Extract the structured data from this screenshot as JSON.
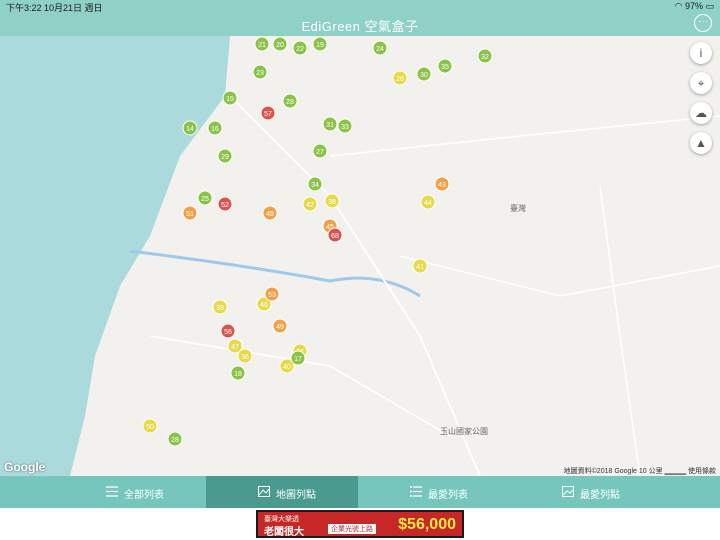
{
  "status_bar": {
    "time_date": "下午3:22  10月21日 週日",
    "battery": "97%"
  },
  "nav": {
    "title": "EdiGreen 空氣盒子",
    "more_icon": "more-icon"
  },
  "map": {
    "labels": [
      "臺灣",
      "玉山國家公園"
    ],
    "google": "Google",
    "attribution": "地圖資料©2018 Google   10 公里 ▁▁▁▁   使用條款",
    "side_buttons": [
      "info-icon",
      "location-pin-icon",
      "weather-icon",
      "layers-icon"
    ],
    "markers": [
      {
        "v": "21",
        "c": "green"
      },
      {
        "v": "20",
        "c": "green"
      },
      {
        "v": "22",
        "c": "green"
      },
      {
        "v": "19",
        "c": "green"
      },
      {
        "v": "24",
        "c": "green"
      },
      {
        "v": "32",
        "c": "green"
      },
      {
        "v": "23",
        "c": "green"
      },
      {
        "v": "30",
        "c": "green"
      },
      {
        "v": "35",
        "c": "green"
      },
      {
        "v": "26",
        "c": "yellow"
      },
      {
        "v": "15",
        "c": "green"
      },
      {
        "v": "28",
        "c": "green"
      },
      {
        "v": "14",
        "c": "green"
      },
      {
        "v": "16",
        "c": "green"
      },
      {
        "v": "57",
        "c": "red"
      },
      {
        "v": "31",
        "c": "green"
      },
      {
        "v": "33",
        "c": "green"
      },
      {
        "v": "27",
        "c": "green"
      },
      {
        "v": "29",
        "c": "green"
      },
      {
        "v": "34",
        "c": "green"
      },
      {
        "v": "43",
        "c": "orange"
      },
      {
        "v": "44",
        "c": "yellow"
      },
      {
        "v": "25",
        "c": "green"
      },
      {
        "v": "42",
        "c": "yellow"
      },
      {
        "v": "38",
        "c": "yellow"
      },
      {
        "v": "45",
        "c": "orange"
      },
      {
        "v": "51",
        "c": "orange"
      },
      {
        "v": "68",
        "c": "red"
      },
      {
        "v": "52",
        "c": "red"
      },
      {
        "v": "48",
        "c": "orange"
      },
      {
        "v": "41",
        "c": "yellow"
      },
      {
        "v": "39",
        "c": "yellow"
      },
      {
        "v": "46",
        "c": "yellow"
      },
      {
        "v": "53",
        "c": "orange"
      },
      {
        "v": "56",
        "c": "red"
      },
      {
        "v": "47",
        "c": "yellow"
      },
      {
        "v": "40",
        "c": "yellow"
      },
      {
        "v": "49",
        "c": "orange"
      },
      {
        "v": "36",
        "c": "yellow"
      },
      {
        "v": "37",
        "c": "yellow"
      },
      {
        "v": "18",
        "c": "green"
      },
      {
        "v": "17",
        "c": "green"
      },
      {
        "v": "50",
        "c": "yellow"
      },
      {
        "v": "28",
        "c": "green"
      }
    ]
  },
  "tabs": [
    {
      "label": "全部列表",
      "icon": "list-icon"
    },
    {
      "label": "地圖列點",
      "icon": "map-icon",
      "active": true
    },
    {
      "label": "最愛列表",
      "icon": "favorite-list-icon"
    },
    {
      "label": "最愛列點",
      "icon": "favorite-map-icon"
    }
  ],
  "ad": {
    "line1": "臺灣大樂透",
    "line2": "老闆很大",
    "line3": "企業光號上路",
    "price": "$56,000"
  },
  "colors": {
    "header": "#8fd0c7",
    "tabbar": "#76c6bd",
    "tab_active": "#4a9a8f",
    "green": "#8bc34a",
    "yellow": "#e6d94a",
    "orange": "#f0a04a",
    "red": "#d9534f"
  }
}
